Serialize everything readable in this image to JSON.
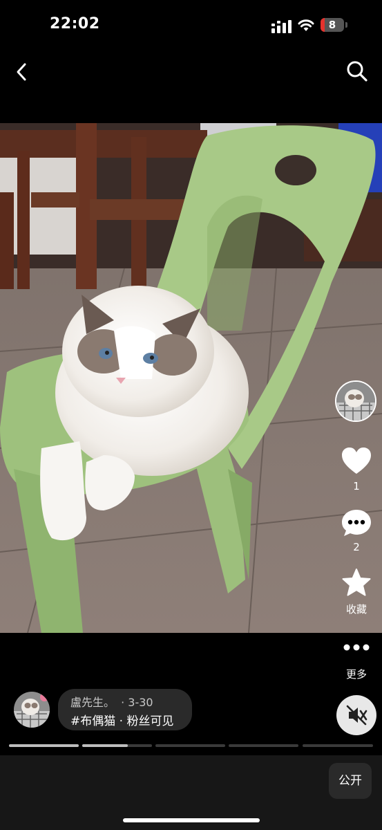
{
  "status_bar": {
    "time": "22:02",
    "battery_level": "8",
    "battery_color": "#e5322d"
  },
  "nav": {
    "back_icon": "chevron-left-icon",
    "search_icon": "search-icon"
  },
  "rail": {
    "like_count": "1",
    "comment_count": "2",
    "favorite_label": "收藏",
    "more_label": "更多"
  },
  "post": {
    "author": "盧先生。",
    "date": "· 3-30",
    "tags": "#布偶猫 · 粉丝可见"
  },
  "bottom": {
    "public_label": "公开"
  },
  "progress": {
    "segments": 5,
    "active_segment": 2,
    "active_fill": 0.65
  }
}
